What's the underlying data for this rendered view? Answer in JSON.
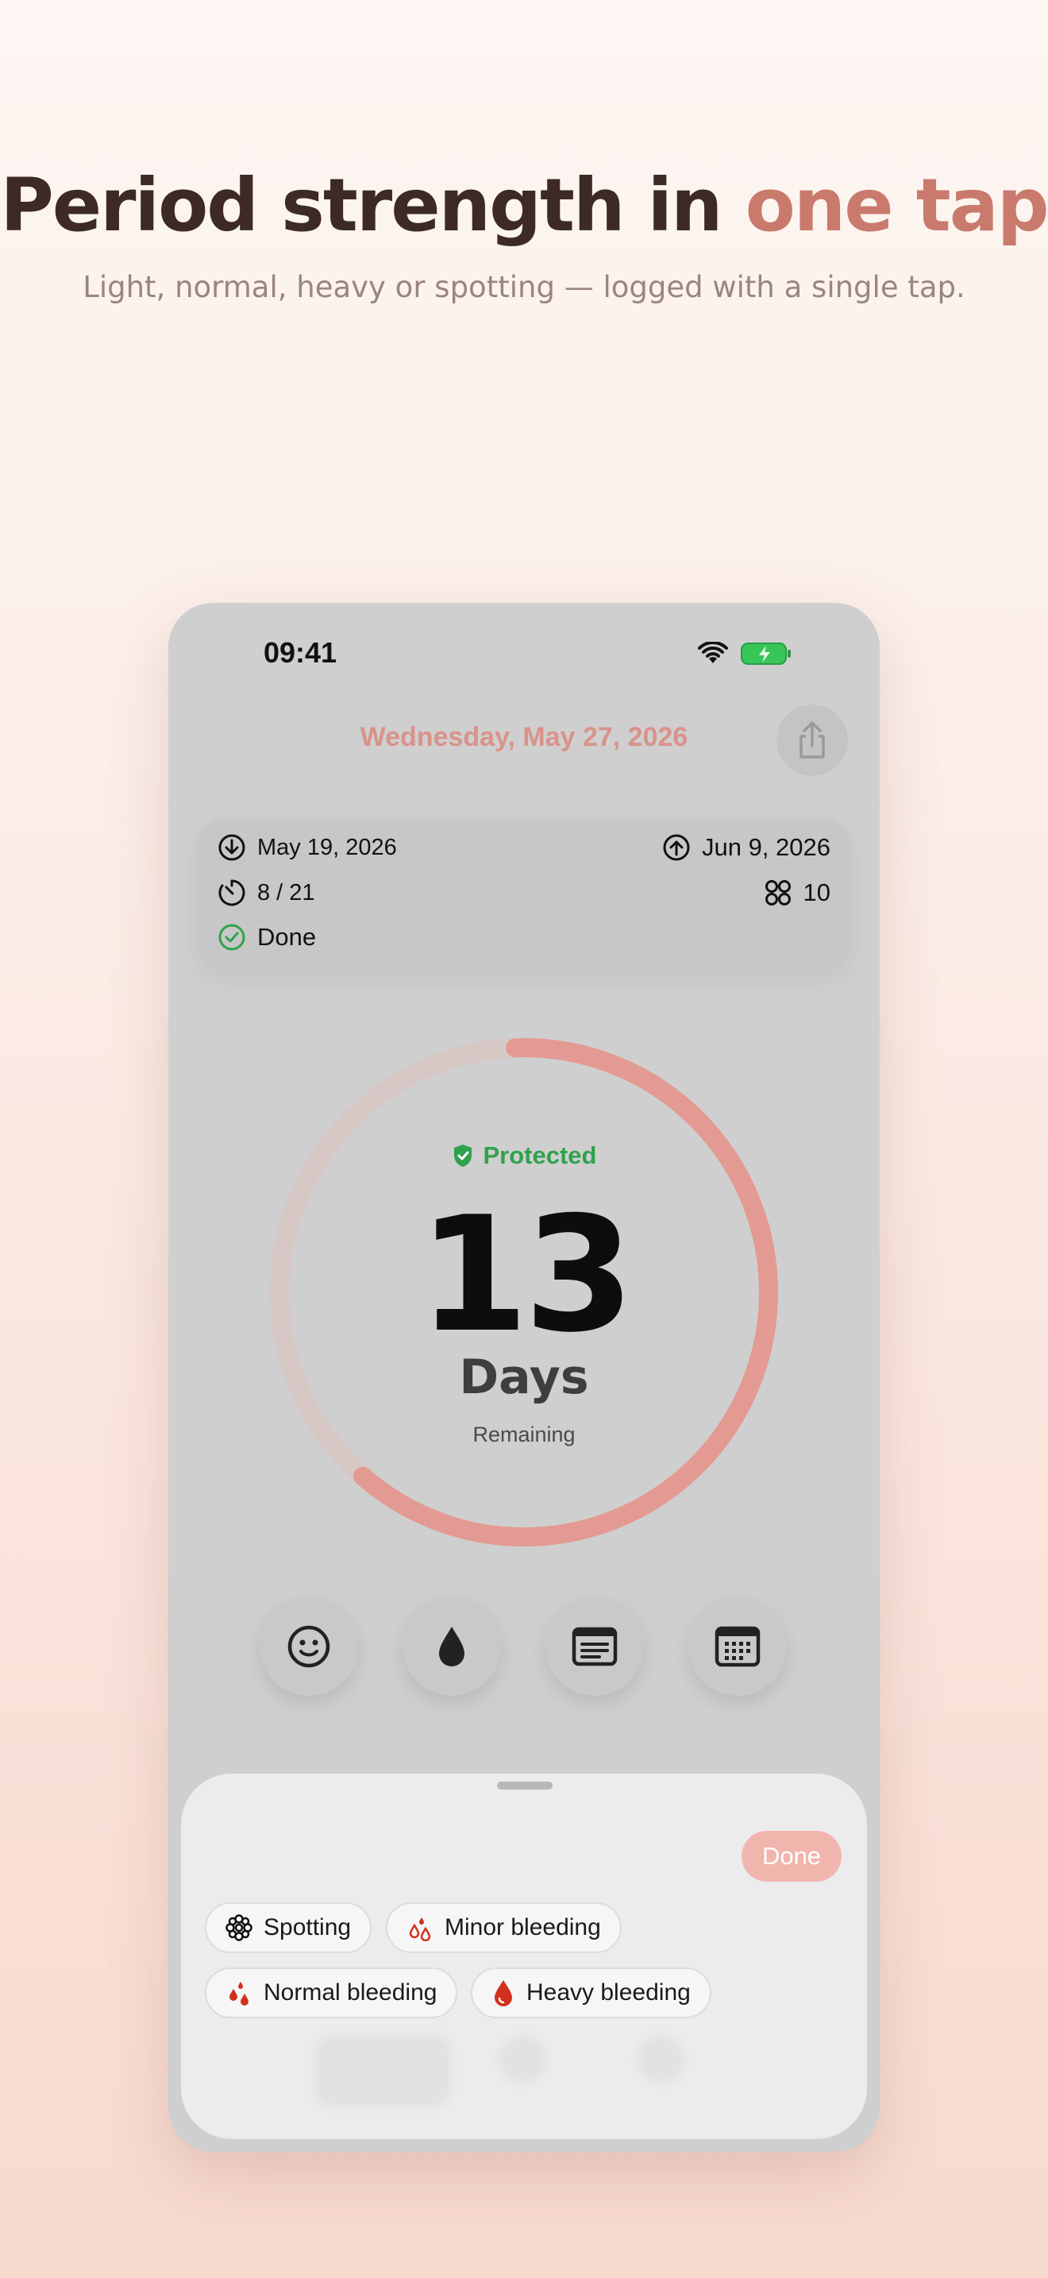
{
  "headline": {
    "main": "Period strength in ",
    "accent": "one tap"
  },
  "subheadline": "Light, normal, heavy or spotting — logged with a single tap.",
  "status_bar": {
    "time": "09:41"
  },
  "header": {
    "date": "Wednesday, May 27, 2026",
    "share_icon": "share-icon"
  },
  "cycle_card": {
    "start_date": "May 19, 2026",
    "next_date": "Jun 9, 2026",
    "pill_progress": "8 / 21",
    "pill_count": "10",
    "status": "Done"
  },
  "ring": {
    "status": "Protected",
    "days": "13",
    "days_label": "Days",
    "sub_label": "Remaining",
    "progress_fraction": 0.62,
    "accent_color": "#e39a92"
  },
  "actions": [
    {
      "icon": "smiley-icon"
    },
    {
      "icon": "drop-icon"
    },
    {
      "icon": "notes-icon"
    },
    {
      "icon": "calendar-icon"
    }
  ],
  "sheet": {
    "done_label": "Done",
    "options": [
      {
        "label": "Spotting",
        "icon": "spotting-icon"
      },
      {
        "label": "Minor bleeding",
        "icon": "minor-bleeding-icon"
      },
      {
        "label": "Normal bleeding",
        "icon": "normal-bleeding-icon"
      },
      {
        "label": "Heavy bleeding",
        "icon": "heavy-bleeding-icon"
      }
    ]
  },
  "colors": {
    "accent": "#c97a6d",
    "protected": "#2fa24c",
    "done_button": "#f2b5ae"
  }
}
